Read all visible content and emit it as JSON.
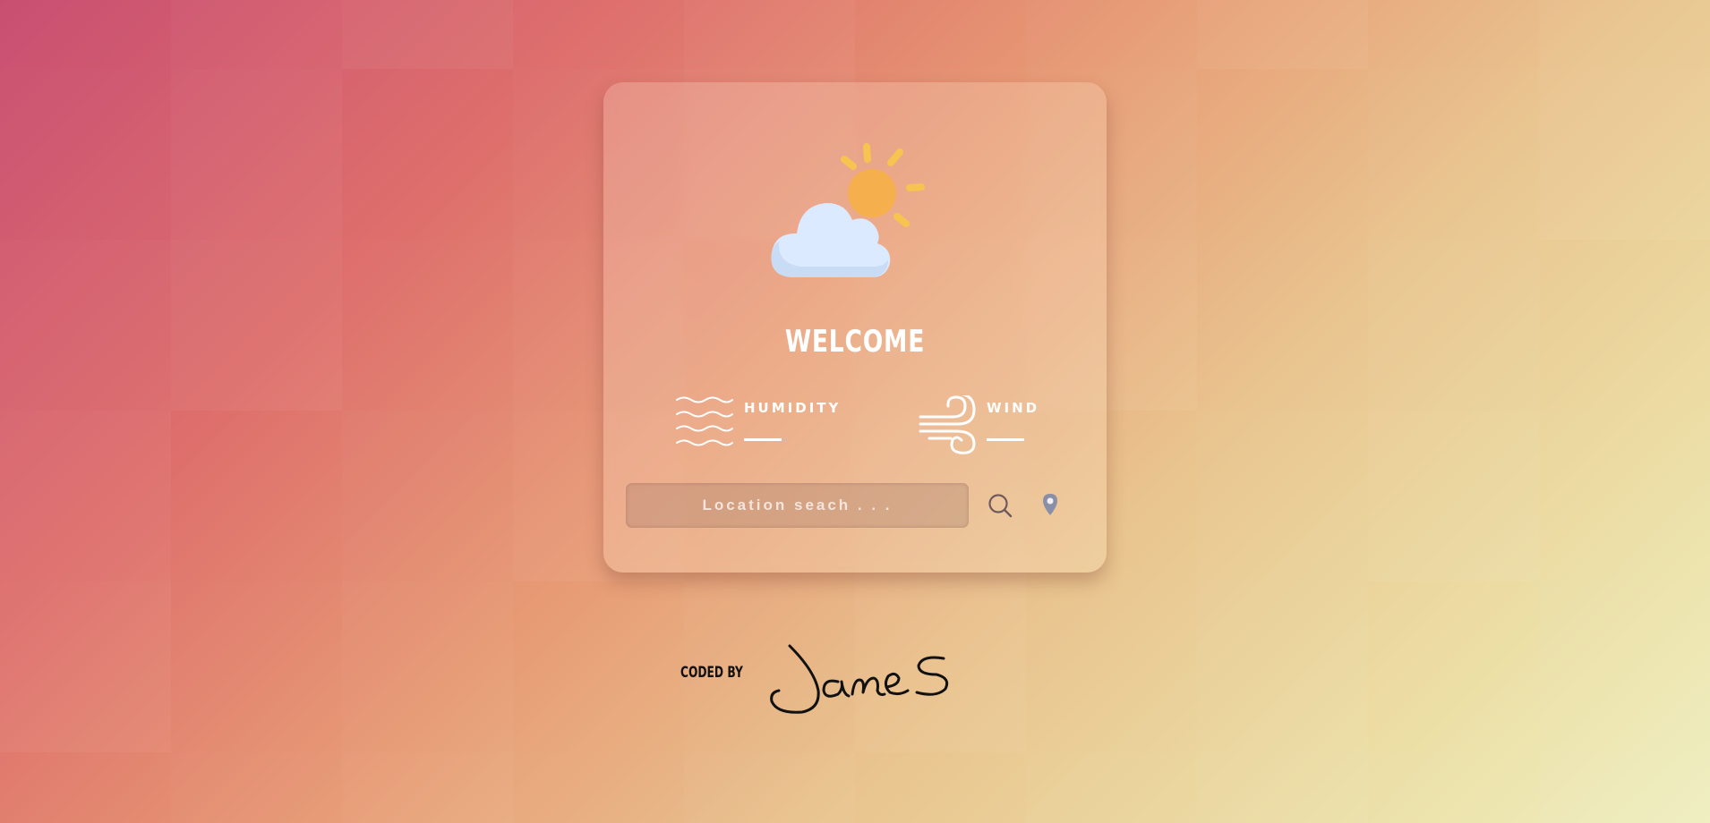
{
  "card": {
    "welcome_title": "WELCOME",
    "weather_icon": "partly-cloudy-icon",
    "humidity": {
      "label": "HUMIDITY",
      "value": "",
      "icon": "humidity-waves-icon"
    },
    "wind": {
      "label": "WIND",
      "value": "",
      "icon": "wind-icon"
    },
    "search": {
      "placeholder": "Location seach . . .",
      "value": ""
    },
    "search_button_icon": "search-icon",
    "location_button_icon": "location-pin-icon"
  },
  "footer": {
    "coded_by": "CODED BY",
    "signature": "James"
  },
  "colors": {
    "background_gradient": [
      "#c94f72",
      "#de6f6c",
      "#e79a74",
      "#e9c48e",
      "#ecdfa6",
      "#efefc0"
    ],
    "sun": "#f5b04d",
    "cloud": "#dbeaff",
    "text": "#ffffff"
  }
}
